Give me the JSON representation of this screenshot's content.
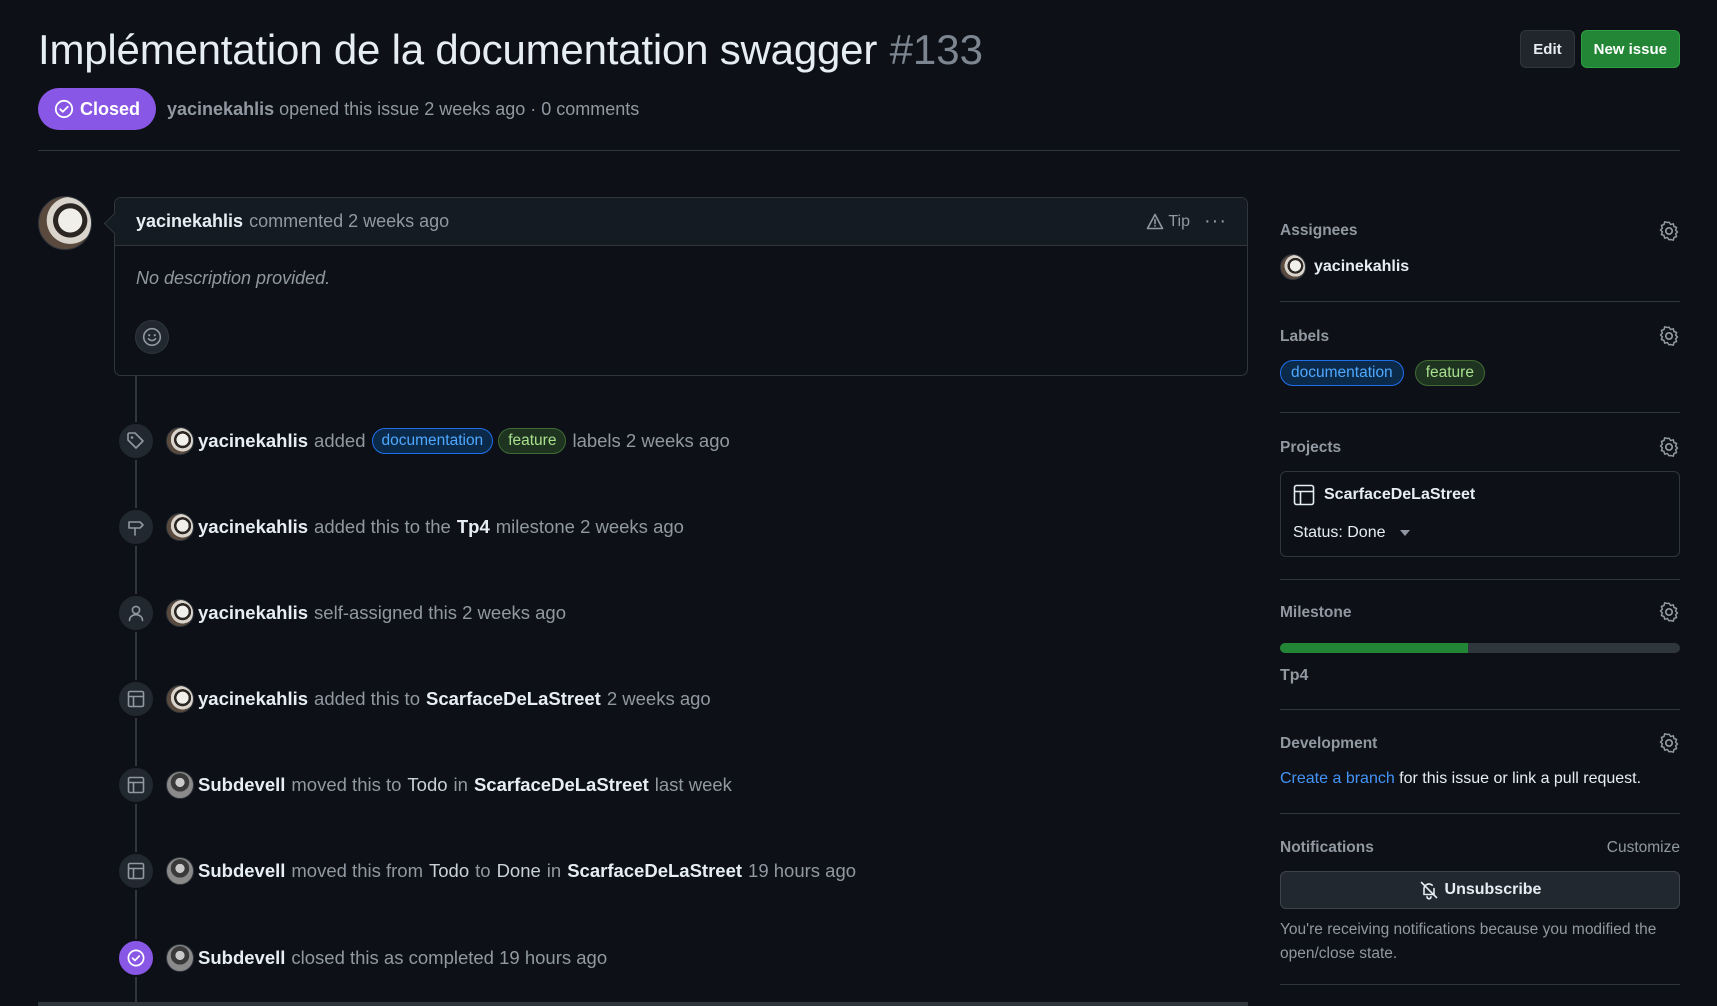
{
  "issue": {
    "title": "Implémentation de la documentation swagger",
    "number": "#133",
    "state": "Closed",
    "author": "yacinekahlis",
    "opened_text": "opened this issue 2 weeks ago · 0 comments"
  },
  "header_actions": {
    "edit_label": "Edit",
    "new_issue_label": "New issue"
  },
  "comment": {
    "author": "yacinekahlis",
    "meta": "commented 2 weeks ago",
    "tip_label": "Tip",
    "more_label": "···",
    "body": "No description provided."
  },
  "timeline": {
    "labels_event": {
      "actor": "yacinekahlis",
      "action": "added",
      "label1": "documentation",
      "label2": "feature",
      "tail": "labels 2 weeks ago"
    },
    "milestone_event": {
      "actor": "yacinekahlis",
      "action": "added this to the",
      "milestone": "Tp4",
      "tail": "milestone 2 weeks ago"
    },
    "assign_event": {
      "actor": "yacinekahlis",
      "action": "self-assigned this 2 weeks ago"
    },
    "project_event": {
      "actor": "yacinekahlis",
      "action": "added this to",
      "project": "ScarfaceDeLaStreet",
      "tail": "2 weeks ago"
    },
    "move_event_1": {
      "actor": "Subdevell",
      "action": "moved this to",
      "to": "Todo",
      "in": "in",
      "project": "ScarfaceDeLaStreet",
      "tail": "last week"
    },
    "move_event_2": {
      "actor": "Subdevell",
      "action": "moved this from",
      "from": "Todo",
      "to_word": "to",
      "to": "Done",
      "in": "in",
      "project": "ScarfaceDeLaStreet",
      "tail": "19 hours ago"
    },
    "close_event": {
      "actor": "Subdevell",
      "action": "closed this as completed 19 hours ago"
    }
  },
  "sidebar": {
    "assignees": {
      "title": "Assignees",
      "user": "yacinekahlis"
    },
    "labels": {
      "title": "Labels",
      "items": [
        "documentation",
        "feature"
      ]
    },
    "projects": {
      "title": "Projects",
      "name": "ScarfaceDeLaStreet",
      "status": "Status: Done"
    },
    "milestone": {
      "title": "Milestone",
      "name": "Tp4",
      "progress": 0.47
    },
    "development": {
      "title": "Development",
      "link": "Create a branch",
      "text": " for this issue or link a pull request."
    },
    "notifications": {
      "title": "Notifications",
      "customize": "Customize",
      "button": "Unsubscribe",
      "reason": "You're receiving notifications because you modified the open/close state."
    }
  },
  "colors": {
    "closed": "#8957e5",
    "primary": "#238636",
    "link": "#4493f8",
    "bg": "#0d1117"
  }
}
